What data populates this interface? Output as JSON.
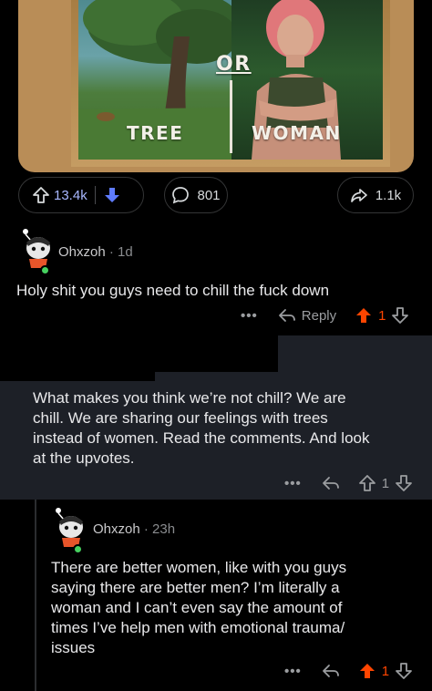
{
  "post": {
    "image": {
      "left_label": "TREE",
      "middle_label": "OR",
      "right_label": "WOMAN"
    },
    "actions": {
      "upvotes": "13.4k",
      "comments": "801",
      "shares": "1.1k"
    }
  },
  "comments": [
    {
      "username": "Ohxzoh",
      "age": "1d",
      "body": "Holy shit you guys need to chill the fuck down",
      "reply_label": "Reply",
      "votes": "1",
      "upvoted": true
    },
    {
      "body_lines": [
        "What makes you think we’re not chill? We are",
        "chill. We are sharing our feelings with trees",
        "instead of women. Read the comments. And look",
        "at the upvotes."
      ],
      "votes": "1",
      "upvoted": false
    },
    {
      "username": "Ohxzoh",
      "age": "23h",
      "body_lines": [
        "There are better women, like with you guys",
        "saying there are better men? I’m literally a",
        "woman and I can’t even say the amount of",
        "times I’ve help men with emotional trauma/",
        "issues"
      ],
      "votes": "1",
      "upvoted": true
    }
  ],
  "colors": {
    "upvote_active": "#ff4500",
    "downvote_active": "#5f7cff",
    "vote_count": "#a8b7ff",
    "online": "#46d160",
    "background": "#000000",
    "highlight_bg": "#1d2027"
  },
  "icons": {
    "upvote": "arrow-up-icon",
    "downvote": "arrow-down-icon",
    "comment": "speech-bubble-icon",
    "share": "share-arrow-icon",
    "reply": "reply-arrow-icon",
    "more": "more-dots-icon"
  }
}
